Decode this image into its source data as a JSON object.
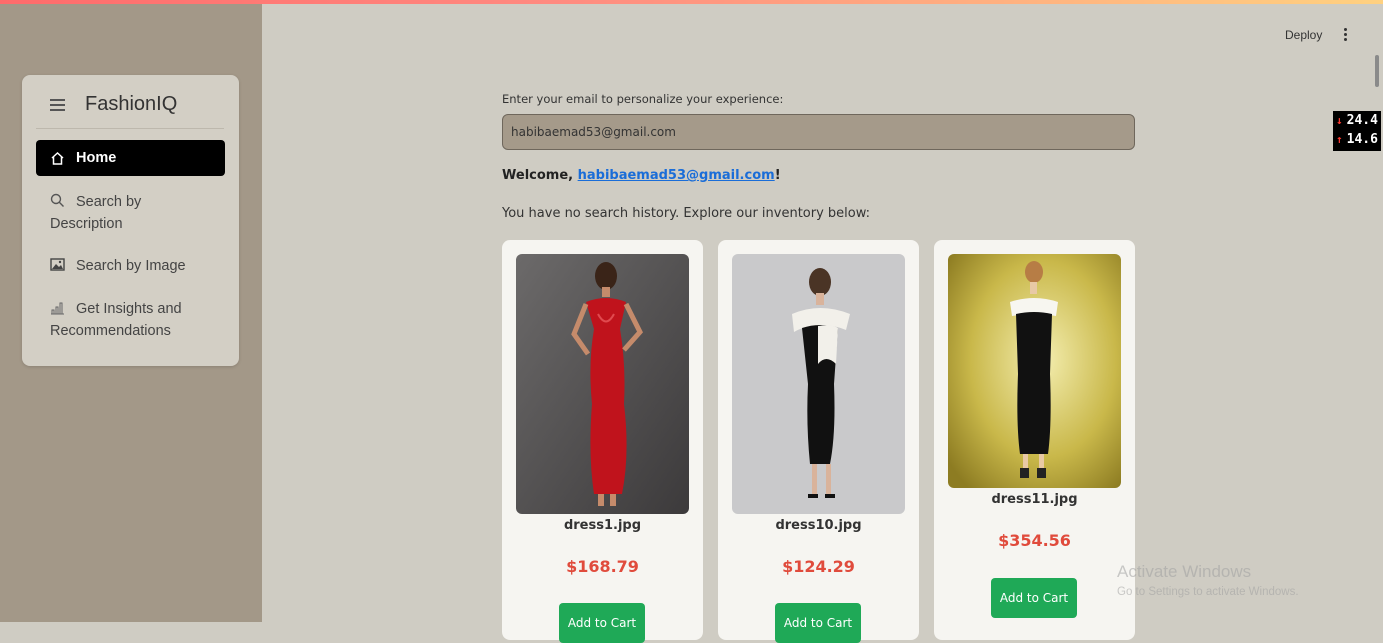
{
  "sidebar": {
    "brand": "FashionIQ",
    "items": [
      {
        "label": "Home",
        "icon": "home-icon"
      },
      {
        "label": "Search by",
        "label2": "Description",
        "icon": "search-icon"
      },
      {
        "label": "Search by Image",
        "icon": "image-icon"
      },
      {
        "label": "Get Insights and",
        "label2": "Recommendations",
        "icon": "bar-chart-icon"
      }
    ]
  },
  "header": {
    "deploy_label": "Deploy"
  },
  "overlay": {
    "value_1": "24.4",
    "value_2": "14.6"
  },
  "main": {
    "email_label": "Enter your email to personalize your experience:",
    "email_value": "habibaemad53@gmail.com",
    "welcome_prefix": "Welcome,",
    "welcome_email": "habibaemad53@gmail.com",
    "welcome_suffix": "!",
    "history_text": "You have no search history. Explore our inventory below:",
    "products": [
      {
        "file": "dress1.jpg",
        "price": "$168.79",
        "button": "Add to Cart"
      },
      {
        "file": "dress10.jpg",
        "price": "$124.29",
        "button": "Add to Cart"
      },
      {
        "file": "dress11.jpg",
        "price": "$354.56",
        "button": "Add to Cart"
      }
    ]
  },
  "watermark": {
    "title": "Activate Windows",
    "subtitle": "Go to Settings to activate Windows."
  },
  "colors": {
    "accent_button": "#1fa957",
    "price": "#e04b3c",
    "sidebar_bg": "#a39888",
    "main_bg": "#cfccc3"
  }
}
